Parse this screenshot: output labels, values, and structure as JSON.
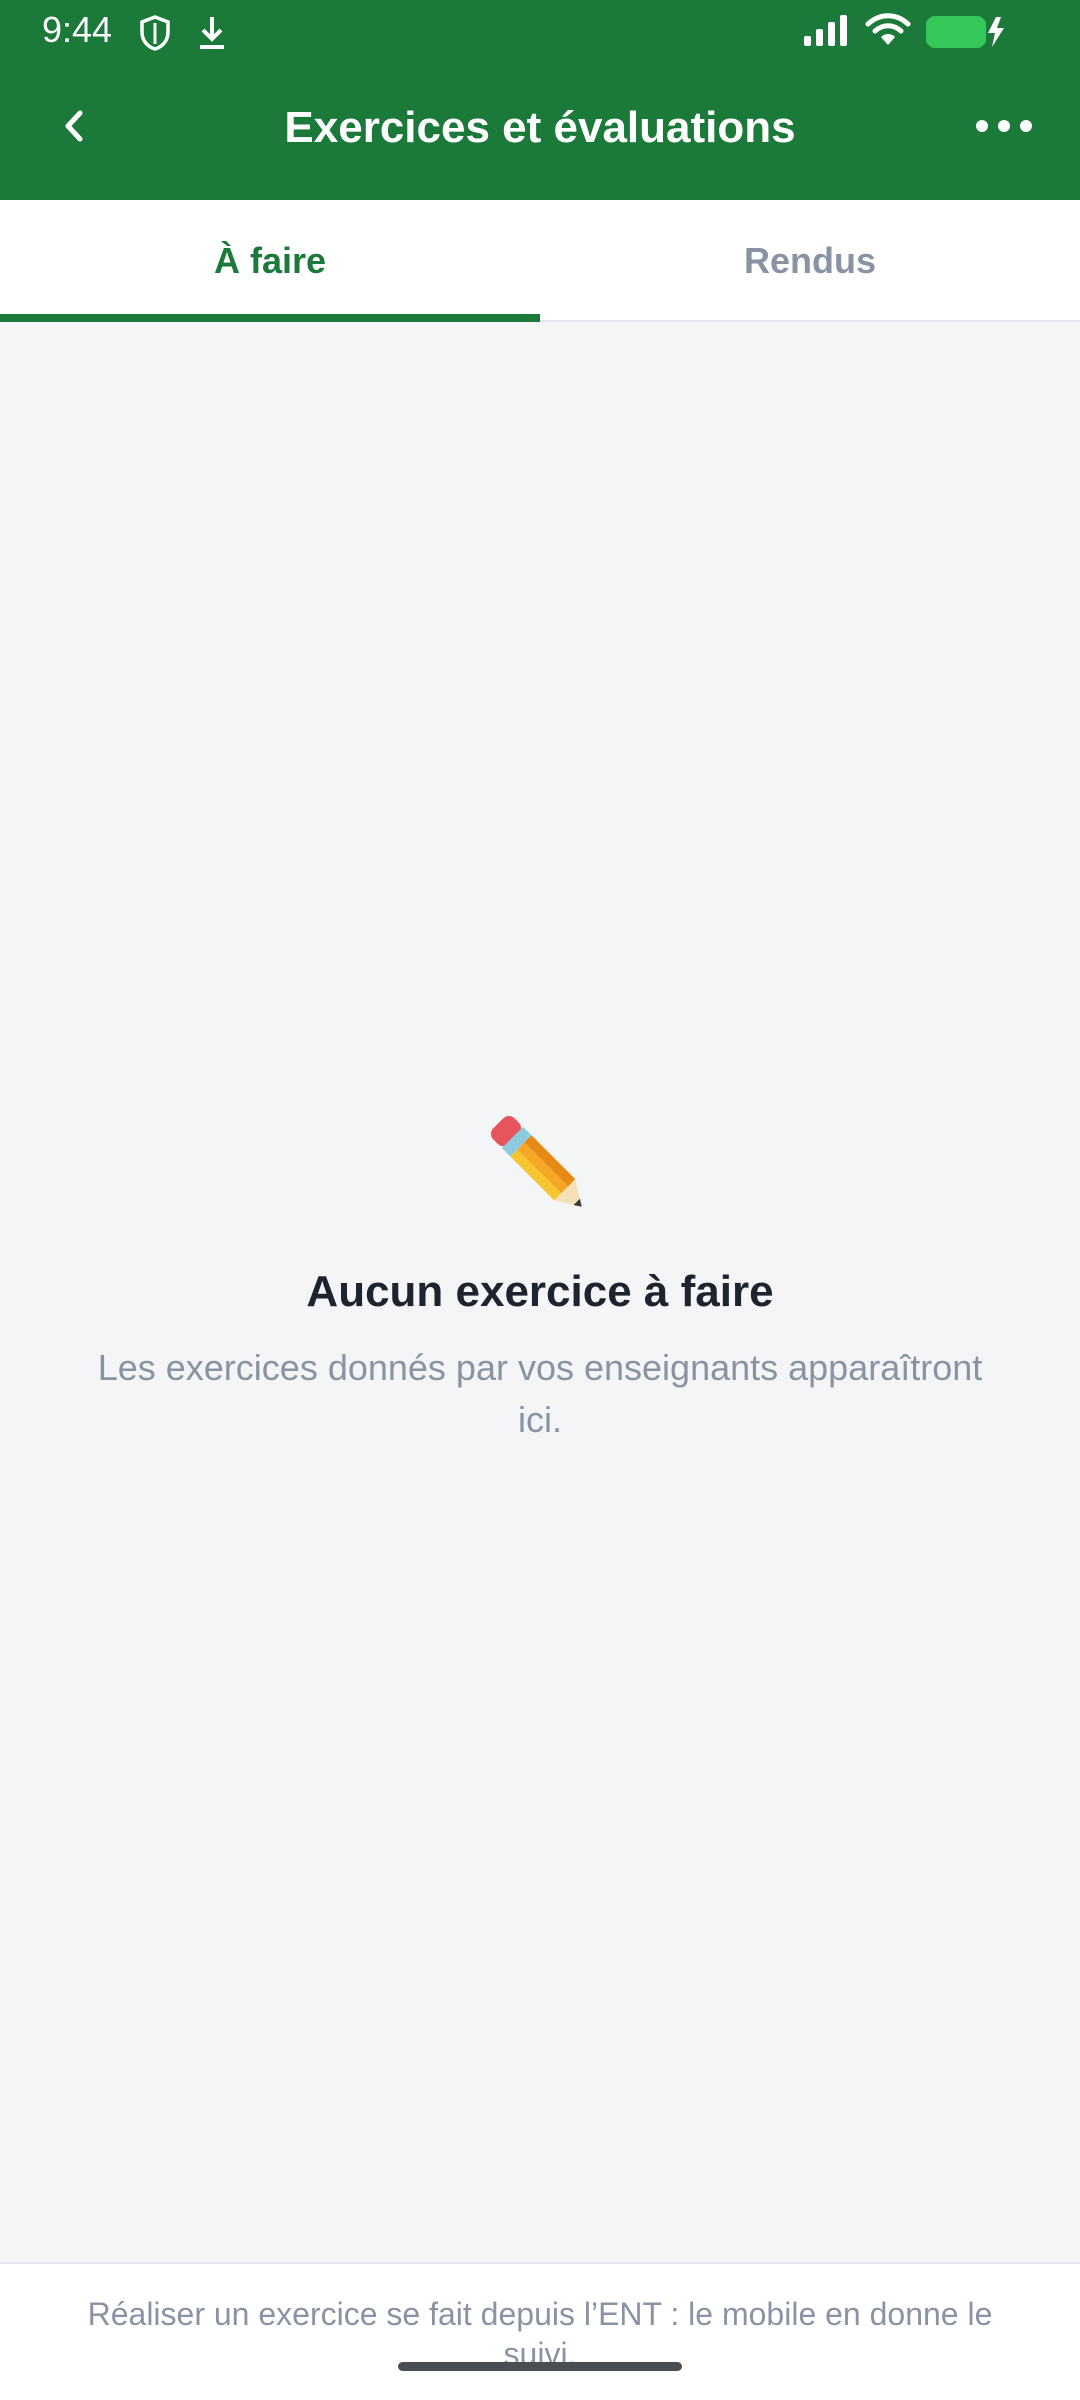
{
  "status_bar": {
    "time": "9:44",
    "icons": [
      "shield-icon",
      "download-icon",
      "signal-icon",
      "wifi-icon",
      "battery-charging-icon"
    ],
    "battery_color": "#35c759"
  },
  "header": {
    "title": "Exercices et évaluations",
    "background": "#1b7a3a",
    "back_icon": "chevron-left-icon",
    "more_icon": "more-horizontal-icon"
  },
  "tabs": [
    {
      "label": "À faire",
      "active": true
    },
    {
      "label": "Rendus",
      "active": false
    }
  ],
  "empty_state": {
    "icon": "pencil-icon",
    "title": "Aucun exercice à faire",
    "subtitle": "Les exercices donnés par vos enseignants apparaîtront ici."
  },
  "footer": {
    "text": "Réaliser un exercice se fait depuis l’ENT : le mobile en donne le suivi."
  },
  "colors": {
    "accent": "#1b7a3a",
    "muted_text": "#8a93a3",
    "dark_text": "#1f2330",
    "background": "#f4f5f7"
  }
}
